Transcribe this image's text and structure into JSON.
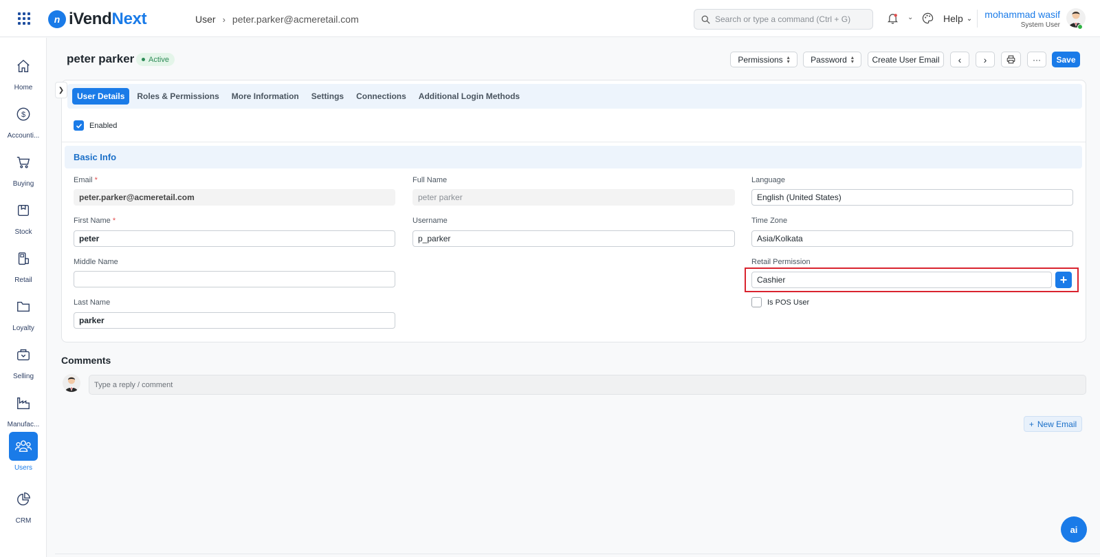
{
  "app": {
    "brand_prefix": "i",
    "brand_main": "Vend",
    "brand_accent": "Next",
    "brand_mark": "n"
  },
  "breadcrumb": {
    "items": [
      "User",
      "peter.parker@acmeretail.com"
    ]
  },
  "search": {
    "placeholder": "Search or type a command (Ctrl + G)"
  },
  "topbar": {
    "help_label": "Help",
    "user_name": "mohammad wasif",
    "user_role": "System User"
  },
  "sidebar": {
    "items": [
      {
        "label": "Home",
        "icon": "home-icon"
      },
      {
        "label": "Accounti...",
        "icon": "dollar-icon"
      },
      {
        "label": "Buying",
        "icon": "cart-icon"
      },
      {
        "label": "Stock",
        "icon": "box-icon"
      },
      {
        "label": "Retail",
        "icon": "pos-icon"
      },
      {
        "label": "Loyalty",
        "icon": "folder-icon"
      },
      {
        "label": "Selling",
        "icon": "bag-icon"
      },
      {
        "label": "Manufac...",
        "icon": "factory-icon"
      },
      {
        "label": "Users",
        "icon": "users-icon",
        "active": true
      },
      {
        "label": "CRM",
        "icon": "pie-icon"
      }
    ]
  },
  "page": {
    "title": "peter parker",
    "status": "Active"
  },
  "actions": {
    "permissions": "Permissions",
    "password": "Password",
    "create_email": "Create User Email",
    "more": "···",
    "save": "Save"
  },
  "tabs": [
    {
      "label": "User Details",
      "active": true
    },
    {
      "label": "Roles & Permissions"
    },
    {
      "label": "More Information"
    },
    {
      "label": "Settings"
    },
    {
      "label": "Connections"
    },
    {
      "label": "Additional Login Methods"
    }
  ],
  "form": {
    "enabled_label": "Enabled",
    "enabled": true,
    "section_title": "Basic Info",
    "email_label": "Email",
    "email_value": "peter.parker@acmeretail.com",
    "full_name_label": "Full Name",
    "full_name_value": "peter parker",
    "language_label": "Language",
    "language_value": "English (United States)",
    "first_name_label": "First Name",
    "first_name_value": "peter",
    "username_label": "Username",
    "username_value": "p_parker",
    "timezone_label": "Time Zone",
    "timezone_value": "Asia/Kolkata",
    "middle_name_label": "Middle Name",
    "middle_name_value": "",
    "retail_permission_label": "Retail Permission",
    "retail_permission_value": "Cashier",
    "last_name_label": "Last Name",
    "last_name_value": "parker",
    "pos_user_label": "Is POS User",
    "pos_user": false,
    "required_mark": "*"
  },
  "comments": {
    "title": "Comments",
    "placeholder": "Type a reply / comment",
    "new_email": "New Email"
  },
  "ai_button": "ai",
  "colors": {
    "primary": "#1a7be8",
    "highlight": "#d9232e",
    "active_badge": "#2e8b57"
  }
}
